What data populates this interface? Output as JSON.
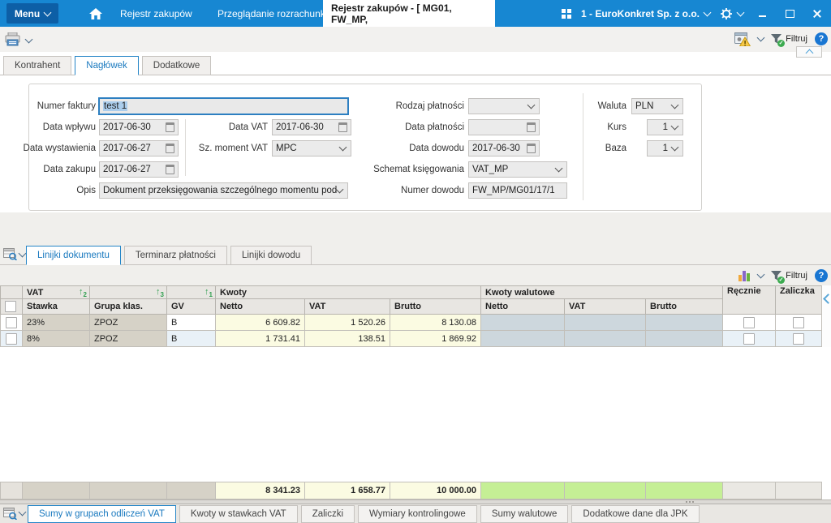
{
  "titlebar": {
    "menu_label": "Menu",
    "nav_tab_1": "Rejestr zakupów",
    "nav_tab_2": "Przeglądanie rozrachunków",
    "doc_tab": "Rejestr zakupów - [ MG01, FW_MP,",
    "company": "1 - EuroKonkret Sp. z o.o."
  },
  "toolbar": {
    "filter_label": "Filtruj",
    "help_label": "?"
  },
  "header_tabs": {
    "kontrahent": "Kontrahent",
    "naglowek": "Nagłówek",
    "dodatkowe": "Dodatkowe"
  },
  "form": {
    "numer_faktury": {
      "label": "Numer faktury",
      "value": "test 1"
    },
    "data_wplywu": {
      "label": "Data wpływu",
      "value": "2017-06-30"
    },
    "data_wystawienia": {
      "label": "Data wystawienia",
      "value": "2017-06-27"
    },
    "data_zakupu": {
      "label": "Data zakupu",
      "value": "2017-06-27"
    },
    "opis": {
      "label": "Opis",
      "value": "Dokument przeksięgowania szczególnego momentu podatk"
    },
    "data_vat": {
      "label": "Data VAT",
      "value": "2017-06-30"
    },
    "sz_moment_vat": {
      "label": "Sz. moment VAT",
      "value": "MPC"
    },
    "rodzaj_platnosci": {
      "label": "Rodzaj płatności",
      "value": ""
    },
    "data_platnosci": {
      "label": "Data płatności",
      "value": ""
    },
    "data_dowodu": {
      "label": "Data dowodu",
      "value": "2017-06-30"
    },
    "schemat_ksiegowania": {
      "label": "Schemat księgowania",
      "value": "VAT_MP"
    },
    "numer_dowodu": {
      "label": "Numer dowodu",
      "value": "FW_MP/MG01/17/1"
    },
    "waluta": {
      "label": "Waluta",
      "value": "PLN"
    },
    "kurs": {
      "label": "Kurs",
      "value": "1"
    },
    "baza": {
      "label": "Baza",
      "value": "1"
    }
  },
  "detail_tabs": {
    "linijki_dokumentu": "Linijki dokumentu",
    "terminarz": "Terminarz płatności",
    "linijki_dowodu": "Linijki dowodu"
  },
  "grid": {
    "group_vat": "VAT",
    "group_kwoty": "Kwoty",
    "group_walutowe": "Kwoty walutowe",
    "col_recznie": "Ręcznie",
    "col_zaliczka": "Zaliczka",
    "sort_stawka": "2",
    "sort_grupa": "3",
    "sort_gv": "1",
    "cols": {
      "stawka": "Stawka",
      "grupa": "Grupa klas.",
      "gv": "GV",
      "netto": "Netto",
      "vat": "VAT",
      "brutto": "Brutto"
    },
    "rows": [
      {
        "stawka": "23%",
        "grupa": "ZPOZ",
        "gv": "B",
        "netto": "6 609.82",
        "vat": "1 520.26",
        "brutto": "8 130.08"
      },
      {
        "stawka": "8%",
        "grupa": "ZPOZ",
        "gv": "B",
        "netto": "1 731.41",
        "vat": "138.51",
        "brutto": "1 869.92"
      }
    ],
    "totals": {
      "netto": "8 341.23",
      "vat": "1 658.77",
      "brutto": "10 000.00"
    }
  },
  "bottom_tabs": {
    "sumy_grupy": "Sumy w grupach odliczeń VAT",
    "kwoty_stawki": "Kwoty w stawkach VAT",
    "zaliczki": "Zaliczki",
    "wymiary": "Wymiary kontrolingowe",
    "sumy_walutowe": "Sumy walutowe",
    "jpk": "Dodatkowe dane dla JPK"
  },
  "colors": {
    "topbar_blue": "#1787d2",
    "menu_button_blue": "#0d5fa6",
    "accent_blue": "#2585c7",
    "active_tab_text": "#1979bf",
    "sort_arrow_green": "#2f9e4f",
    "filter_check_green": "#3cab50",
    "cell_yellow": "#fbfbe2",
    "cell_taupe": "#d6d2c7",
    "cell_bluegrey": "#cdd7dd",
    "total_green": "#c5ef95"
  }
}
